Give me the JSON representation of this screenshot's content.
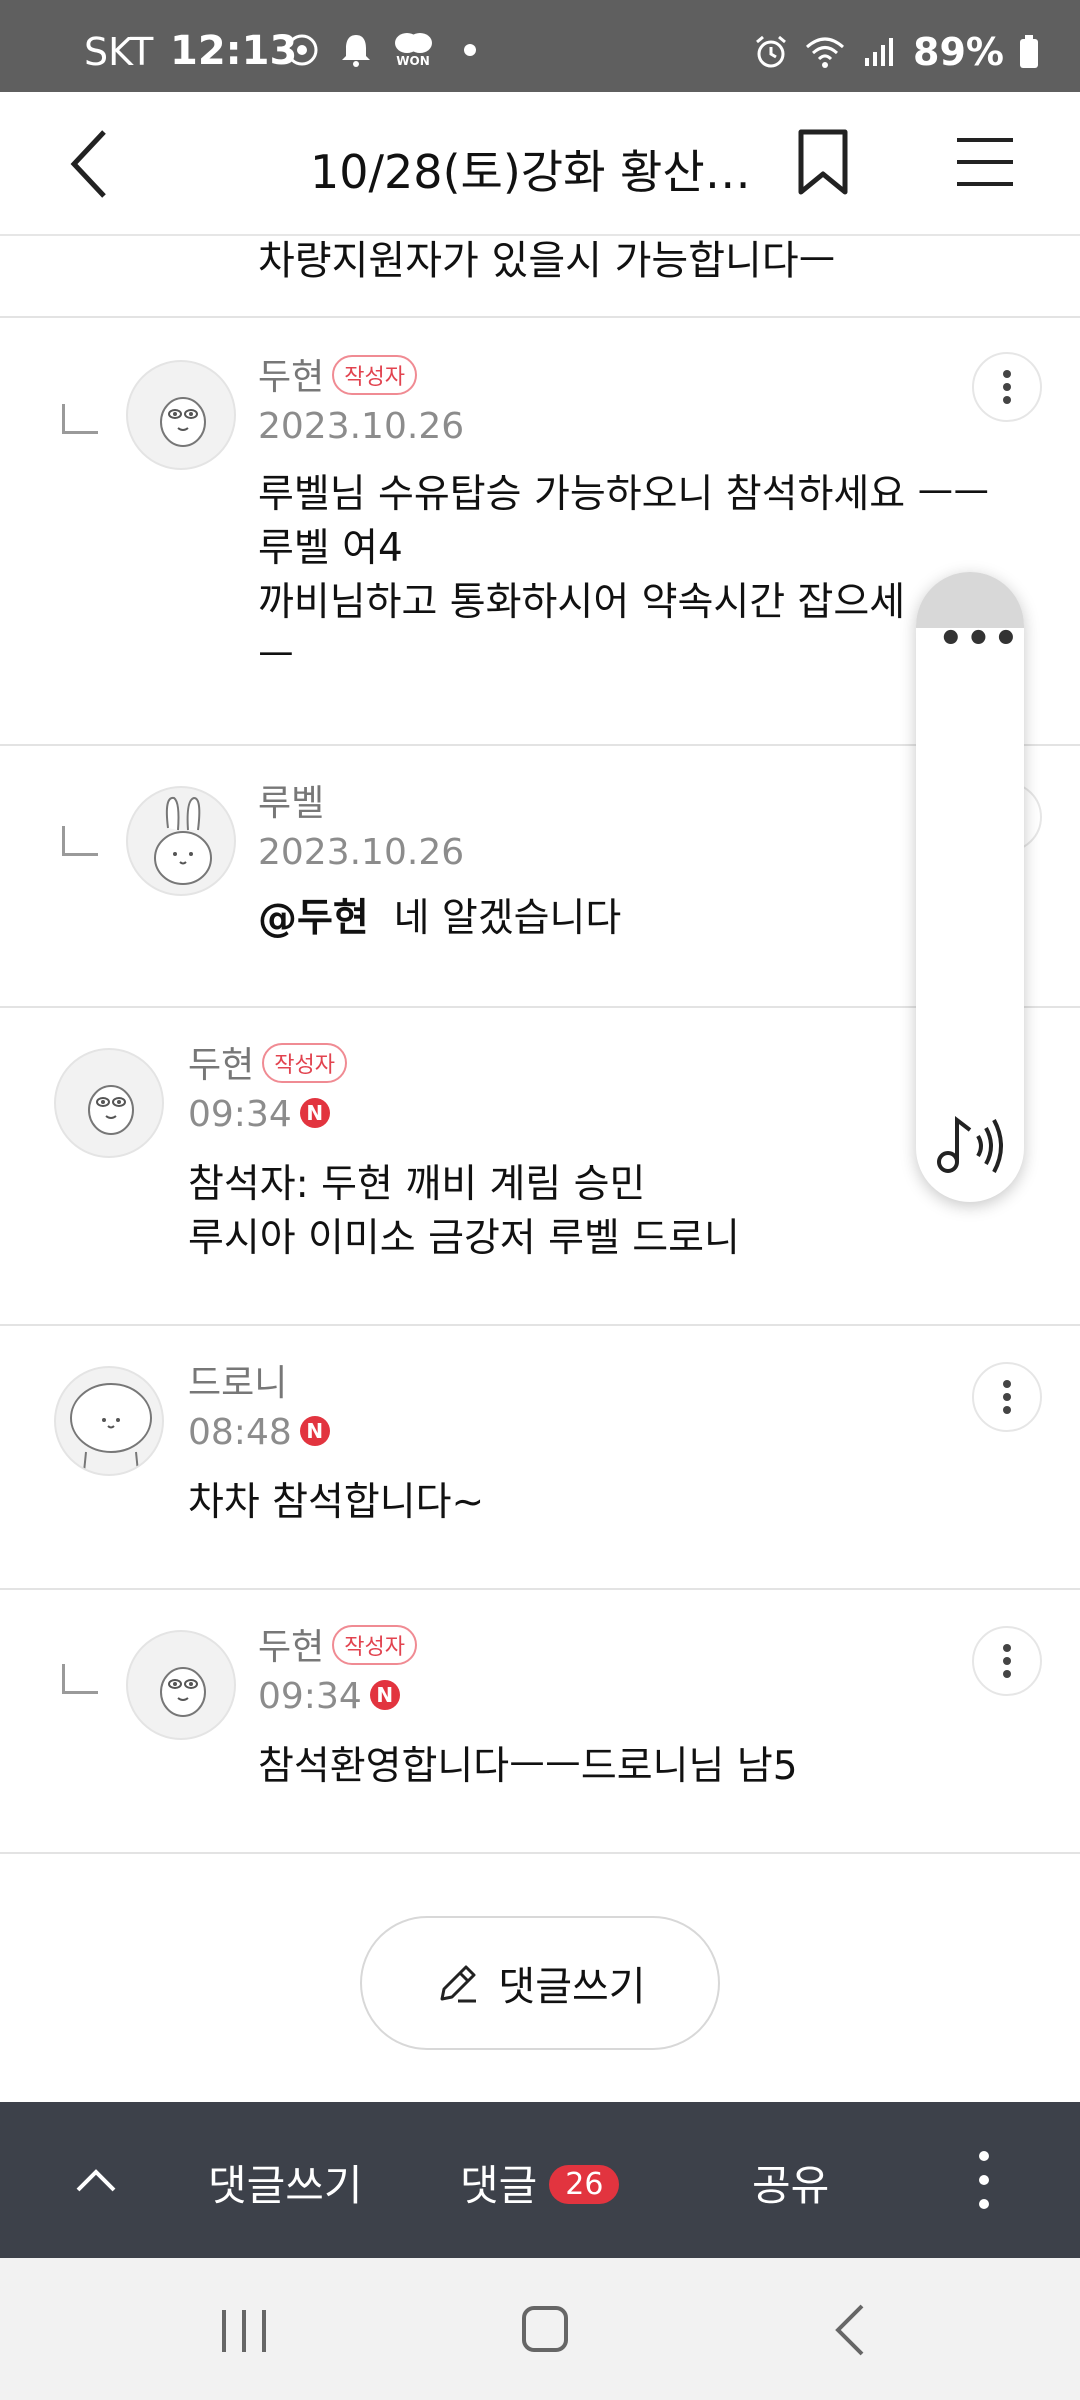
{
  "status_bar": {
    "carrier": "SKT",
    "time": "12:13",
    "won_label": "WON",
    "battery": "89%"
  },
  "header": {
    "title": "10/28(토)강화 황산도..."
  },
  "truncated_text": "차량지원자가 있을시 가능합니다ㅡ",
  "comments": [
    {
      "author": "두현",
      "badge": "작성자",
      "date": "2023.10.26",
      "lines": [
        "루벨님 수유탑승 가능하오니 참석하세요 ㅡㅡ",
        "루벨 여4",
        "까비님하고 통화하시어 약속시간 잡으세",
        "ㅡ"
      ]
    },
    {
      "author": "루벨",
      "date": "2023.10.26",
      "mention": "@두현",
      "text": "네 알겠습니다"
    },
    {
      "author": "두현",
      "badge": "작성자",
      "date": "09:34",
      "new": "N",
      "lines": [
        "참석자: 두현 깨비 계림 승민",
        "루시아 이미소 금강저 루벨 드로니"
      ]
    },
    {
      "author": "드로니",
      "date": "08:48",
      "new": "N",
      "text": "차차 참석합니다~"
    },
    {
      "author": "두현",
      "badge": "작성자",
      "date": "09:34",
      "new": "N",
      "text": "참석환영합니다ㅡㅡ드로니님 남5"
    }
  ],
  "write_button": "댓글쓰기",
  "bottom_bar": {
    "write": "댓글쓰기",
    "comments": "댓글",
    "comment_count": "26",
    "share": "공유"
  },
  "icons": {
    "back": "chevron-left-icon",
    "bookmark": "bookmark-icon",
    "menu": "hamburger-menu-icon",
    "more": "vertical-dots-icon",
    "pencil": "pencil-icon",
    "music": "music-note-sound-icon"
  },
  "colors": {
    "accent_red": "#e2343f",
    "bottom_bar": "#3d414a",
    "status_bar": "#5f5f5f"
  }
}
